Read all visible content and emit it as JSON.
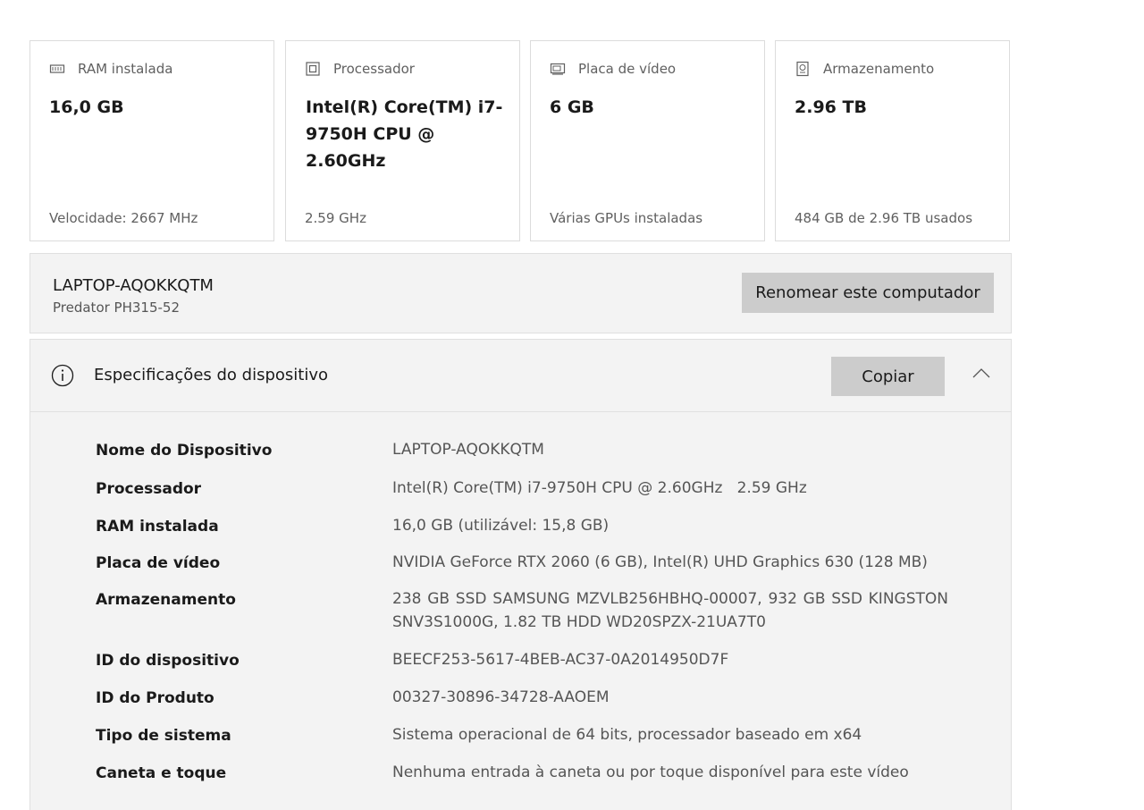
{
  "cards": [
    {
      "icon": "ram-icon",
      "title": "RAM instalada",
      "value": "16,0 GB",
      "footer": "Velocidade: 2667 MHz"
    },
    {
      "icon": "processor-icon",
      "title": "Processador",
      "value": "Intel(R) Core(TM) i7-9750H CPU @ 2.60GHz",
      "footer": "2.59 GHz"
    },
    {
      "icon": "graphics-card-icon",
      "title": "Placa de vídeo",
      "value": "6 GB",
      "footer": "Várias GPUs instaladas"
    },
    {
      "icon": "storage-icon",
      "title": "Armazenamento",
      "value": "2.96 TB",
      "footer": "484 GB de 2.96 TB usados"
    }
  ],
  "computer": {
    "name": "LAPTOP-AQOKKQTM",
    "model": "Predator PH315-52",
    "rename_label": "Renomear este computador"
  },
  "specs": {
    "title": "Especificações do dispositivo",
    "copy_label": "Copiar",
    "rows": [
      {
        "label": "Nome do Dispositivo",
        "value": "LAPTOP-AQOKKQTM"
      },
      {
        "label": "Processador",
        "value": "Intel(R) Core(TM) i7-9750H CPU @ 2.60GHz   2.59 GHz"
      },
      {
        "label": "RAM instalada",
        "value": "16,0 GB (utilizável: 15,8 GB)"
      },
      {
        "label": "Placa de vídeo",
        "value": "NVIDIA GeForce RTX 2060 (6 GB), Intel(R) UHD Graphics 630 (128 MB)"
      },
      {
        "label": "Armazenamento",
        "value": "238 GB SSD SAMSUNG MZVLB256HBHQ-00007, 932 GB SSD KINGSTON SNV3S1000G, 1.82 TB HDD WD20SPZX-21UA7T0"
      },
      {
        "label": "ID do dispositivo",
        "value": "BEECF253-5617-4BEB-AC37-0A2014950D7F"
      },
      {
        "label": "ID do Produto",
        "value": "00327-30896-34728-AAOEM"
      },
      {
        "label": "Tipo de sistema",
        "value": "Sistema operacional de 64 bits, processador baseado em x64"
      },
      {
        "label": "Caneta e toque",
        "value": "Nenhuma entrada à caneta ou por toque disponível para este vídeo"
      }
    ]
  }
}
